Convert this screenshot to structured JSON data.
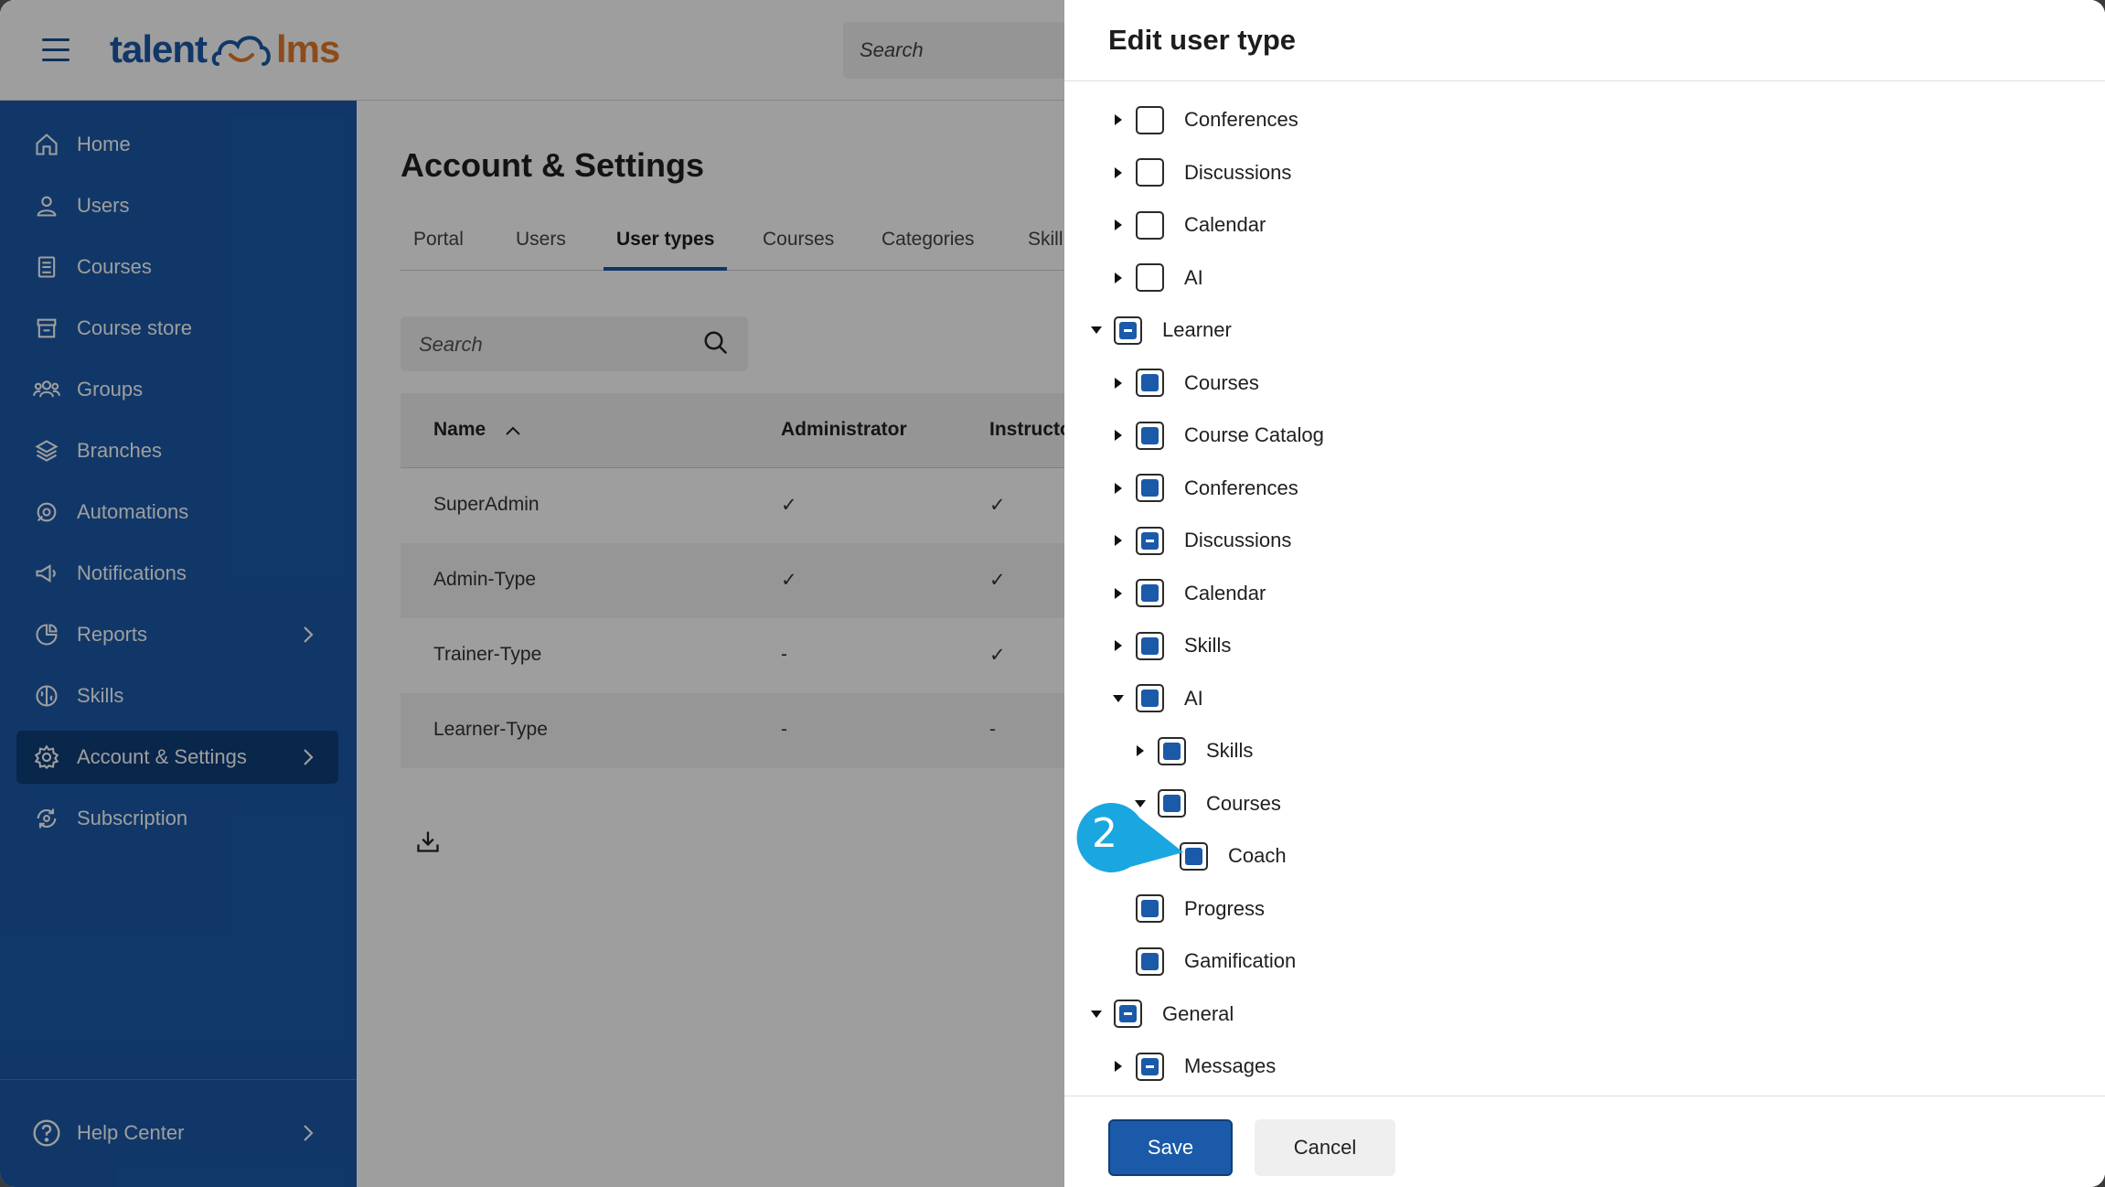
{
  "topbar": {
    "logo_left": "talent",
    "logo_right": "lms",
    "search_placeholder": "Search"
  },
  "sidebar": {
    "items": [
      {
        "label": "Home",
        "icon": "home-icon"
      },
      {
        "label": "Users",
        "icon": "user-icon"
      },
      {
        "label": "Courses",
        "icon": "book-icon"
      },
      {
        "label": "Course store",
        "icon": "store-icon"
      },
      {
        "label": "Groups",
        "icon": "groups-icon"
      },
      {
        "label": "Branches",
        "icon": "layers-icon"
      },
      {
        "label": "Automations",
        "icon": "automation-icon"
      },
      {
        "label": "Notifications",
        "icon": "megaphone-icon"
      },
      {
        "label": "Reports",
        "icon": "pie-chart-icon"
      },
      {
        "label": "Skills",
        "icon": "brain-icon"
      },
      {
        "label": "Account & Settings",
        "icon": "gear-icon"
      },
      {
        "label": "Subscription",
        "icon": "subscription-icon"
      }
    ],
    "help_label": "Help Center"
  },
  "main": {
    "title": "Account & Settings",
    "tabs": [
      "Portal",
      "Users",
      "User types",
      "Courses",
      "Categories",
      "Skill"
    ],
    "active_tab": "User types",
    "search_placeholder": "Search",
    "table": {
      "headers": [
        "Name",
        "Administrator",
        "Instructo"
      ],
      "rows": [
        {
          "name": "SuperAdmin",
          "admin": "✓",
          "instructor": "✓"
        },
        {
          "name": "Admin-Type",
          "admin": "✓",
          "instructor": "✓"
        },
        {
          "name": "Trainer-Type",
          "admin": "-",
          "instructor": "✓"
        },
        {
          "name": "Learner-Type",
          "admin": "-",
          "instructor": "-"
        }
      ]
    }
  },
  "drawer": {
    "title": "Edit user type",
    "tree": [
      {
        "label": "Conferences",
        "state": "unchecked",
        "expander": "collapsed"
      },
      {
        "label": "Discussions",
        "state": "unchecked",
        "expander": "collapsed"
      },
      {
        "label": "Calendar",
        "state": "unchecked",
        "expander": "collapsed"
      },
      {
        "label": "AI",
        "state": "unchecked",
        "expander": "collapsed"
      },
      {
        "label": "Learner",
        "state": "partial",
        "expander": "expanded"
      },
      {
        "label": "Courses",
        "state": "checked",
        "expander": "collapsed"
      },
      {
        "label": "Course Catalog",
        "state": "checked",
        "expander": "collapsed"
      },
      {
        "label": "Conferences",
        "state": "checked",
        "expander": "collapsed"
      },
      {
        "label": "Discussions",
        "state": "partial",
        "expander": "collapsed"
      },
      {
        "label": "Calendar",
        "state": "checked",
        "expander": "collapsed"
      },
      {
        "label": "Skills",
        "state": "checked",
        "expander": "collapsed"
      },
      {
        "label": "AI",
        "state": "checked",
        "expander": "expanded"
      },
      {
        "label": "Skills",
        "state": "checked",
        "expander": "collapsed"
      },
      {
        "label": "Courses",
        "state": "checked",
        "expander": "expanded"
      },
      {
        "label": "Coach",
        "state": "checked",
        "expander": "none"
      },
      {
        "label": "Progress",
        "state": "checked",
        "expander": "none"
      },
      {
        "label": "Gamification",
        "state": "checked",
        "expander": "none"
      },
      {
        "label": "General",
        "state": "partial",
        "expander": "expanded"
      },
      {
        "label": "Messages",
        "state": "partial",
        "expander": "collapsed"
      }
    ],
    "save_label": "Save",
    "cancel_label": "Cancel"
  },
  "callout": {
    "step_number": "2",
    "color": "#1aa7e0"
  },
  "colors": {
    "brand_blue": "#1a5aa8",
    "brand_orange": "#e4792b"
  }
}
